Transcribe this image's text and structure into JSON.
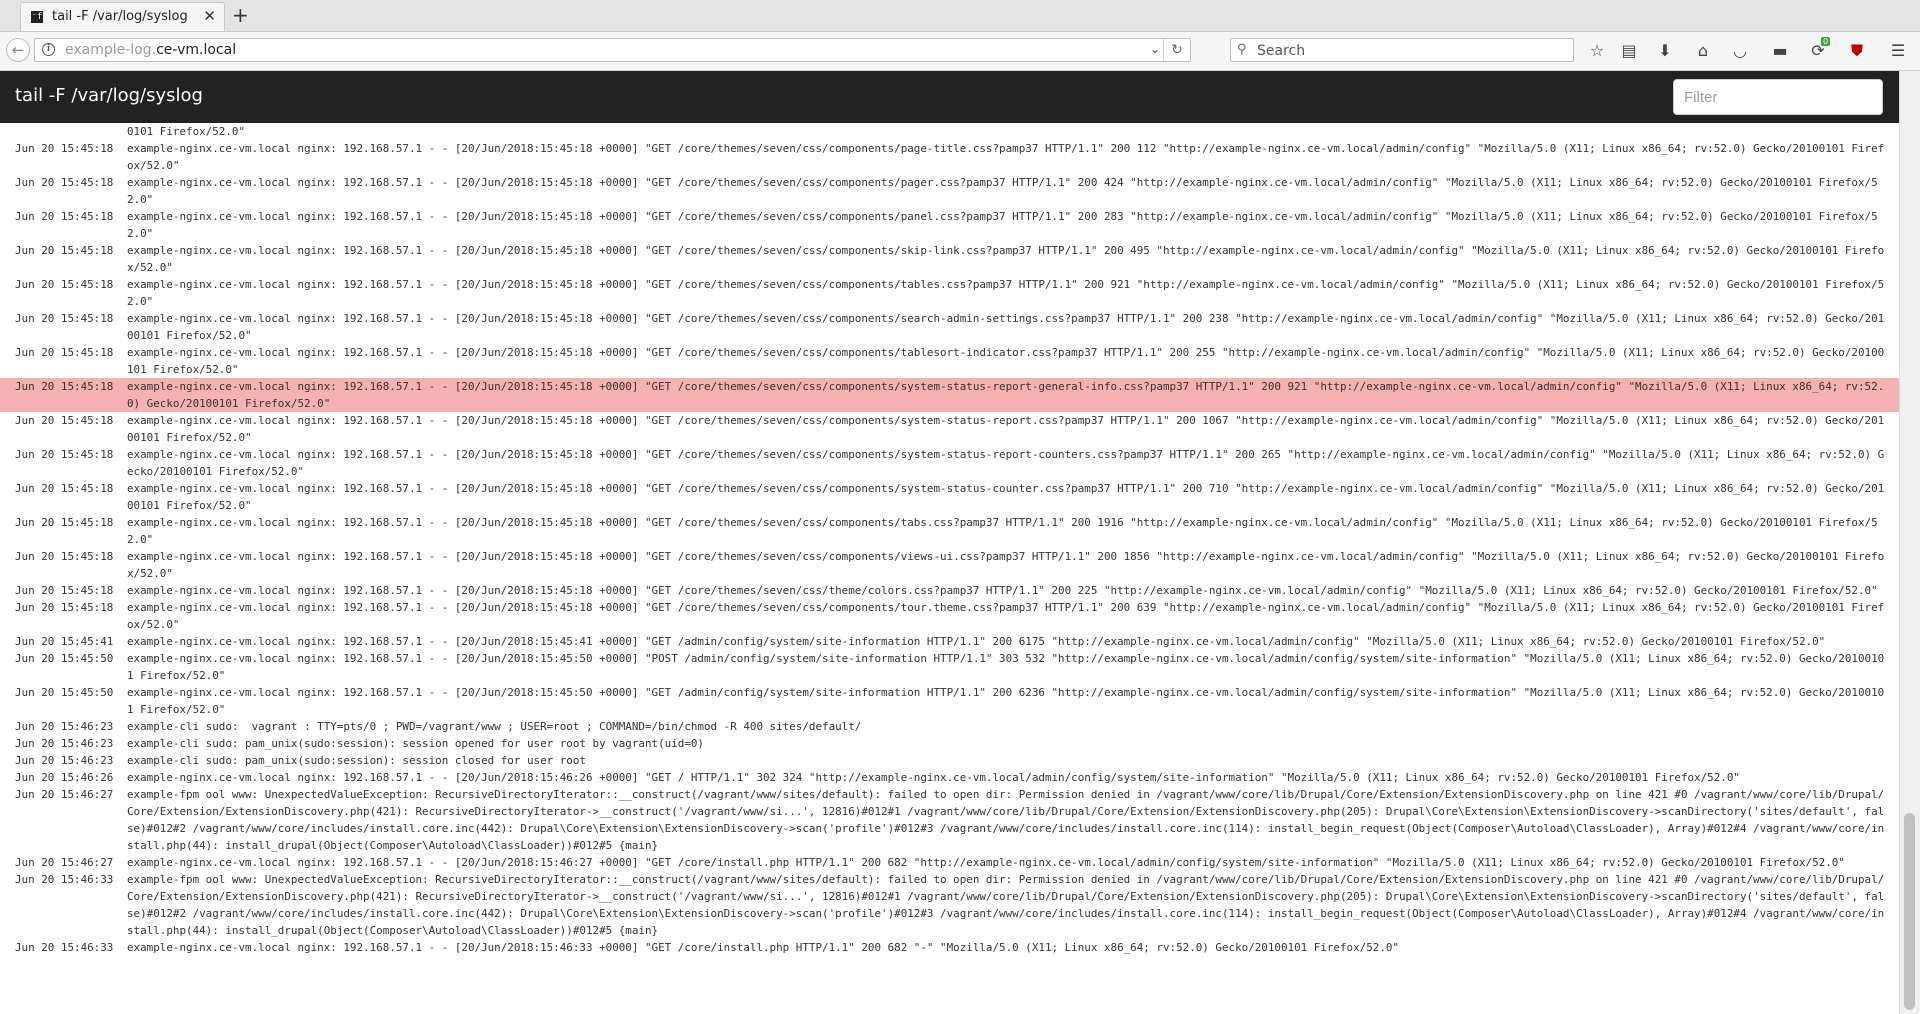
{
  "browser": {
    "tab_title": "tail -F /var/log/syslog",
    "tab_favicon_glyph": "⁻f",
    "url_prefix": "example-log.",
    "url_host": "ce-vm.local",
    "search_placeholder": "Search",
    "toolbar_icons": [
      "star-icon",
      "clipboard-icon",
      "download-icon",
      "home-icon",
      "pocket-icon",
      "extension-icon",
      "sync-icon",
      "ublock-icon",
      "menu-icon"
    ],
    "badge_count": "0"
  },
  "app": {
    "title": "tail -F /var/log/syslog",
    "filter_placeholder": "Filter"
  },
  "colors": {
    "header_bg": "#222222",
    "highlight_bg": "#f6b1b1"
  },
  "log_lines": [
    {
      "ts": "",
      "msg": "0101 Firefox/52.0\""
    },
    {
      "ts": "Jun 20 15:45:18",
      "msg": "example-nginx.ce-vm.local nginx: 192.168.57.1 - - [20/Jun/2018:15:45:18 +0000] \"GET /core/themes/seven/css/components/page-title.css?pamp37 HTTP/1.1\" 200 112 \"http://example-nginx.ce-vm.local/admin/config\" \"Mozilla/5.0 (X11; Linux x86_64; rv:52.0) Gecko/20100101 Firefox/52.0\""
    },
    {
      "ts": "Jun 20 15:45:18",
      "msg": "example-nginx.ce-vm.local nginx: 192.168.57.1 - - [20/Jun/2018:15:45:18 +0000] \"GET /core/themes/seven/css/components/pager.css?pamp37 HTTP/1.1\" 200 424 \"http://example-nginx.ce-vm.local/admin/config\" \"Mozilla/5.0 (X11; Linux x86_64; rv:52.0) Gecko/20100101 Firefox/52.0\""
    },
    {
      "ts": "Jun 20 15:45:18",
      "msg": "example-nginx.ce-vm.local nginx: 192.168.57.1 - - [20/Jun/2018:15:45:18 +0000] \"GET /core/themes/seven/css/components/panel.css?pamp37 HTTP/1.1\" 200 283 \"http://example-nginx.ce-vm.local/admin/config\" \"Mozilla/5.0 (X11; Linux x86_64; rv:52.0) Gecko/20100101 Firefox/52.0\""
    },
    {
      "ts": "Jun 20 15:45:18",
      "msg": "example-nginx.ce-vm.local nginx: 192.168.57.1 - - [20/Jun/2018:15:45:18 +0000] \"GET /core/themes/seven/css/components/skip-link.css?pamp37 HTTP/1.1\" 200 495 \"http://example-nginx.ce-vm.local/admin/config\" \"Mozilla/5.0 (X11; Linux x86_64; rv:52.0) Gecko/20100101 Firefox/52.0\""
    },
    {
      "ts": "Jun 20 15:45:18",
      "msg": "example-nginx.ce-vm.local nginx: 192.168.57.1 - - [20/Jun/2018:15:45:18 +0000] \"GET /core/themes/seven/css/components/tables.css?pamp37 HTTP/1.1\" 200 921 \"http://example-nginx.ce-vm.local/admin/config\" \"Mozilla/5.0 (X11; Linux x86_64; rv:52.0) Gecko/20100101 Firefox/52.0\""
    },
    {
      "ts": "Jun 20 15:45:18",
      "msg": "example-nginx.ce-vm.local nginx: 192.168.57.1 - - [20/Jun/2018:15:45:18 +0000] \"GET /core/themes/seven/css/components/search-admin-settings.css?pamp37 HTTP/1.1\" 200 238 \"http://example-nginx.ce-vm.local/admin/config\" \"Mozilla/5.0 (X11; Linux x86_64; rv:52.0) Gecko/20100101 Firefox/52.0\""
    },
    {
      "ts": "Jun 20 15:45:18",
      "msg": "example-nginx.ce-vm.local nginx: 192.168.57.1 - - [20/Jun/2018:15:45:18 +0000] \"GET /core/themes/seven/css/components/tablesort-indicator.css?pamp37 HTTP/1.1\" 200 255 \"http://example-nginx.ce-vm.local/admin/config\" \"Mozilla/5.0 (X11; Linux x86_64; rv:52.0) Gecko/20100101 Firefox/52.0\""
    },
    {
      "ts": "Jun 20 15:45:18",
      "msg": "example-nginx.ce-vm.local nginx: 192.168.57.1 - - [20/Jun/2018:15:45:18 +0000] \"GET /core/themes/seven/css/components/system-status-report-general-info.css?pamp37 HTTP/1.1\" 200 921 \"http://example-nginx.ce-vm.local/admin/config\" \"Mozilla/5.0 (X11; Linux x86_64; rv:52.0) Gecko/20100101 Firefox/52.0\"",
      "highlight": true
    },
    {
      "ts": "Jun 20 15:45:18",
      "msg": "example-nginx.ce-vm.local nginx: 192.168.57.1 - - [20/Jun/2018:15:45:18 +0000] \"GET /core/themes/seven/css/components/system-status-report.css?pamp37 HTTP/1.1\" 200 1067 \"http://example-nginx.ce-vm.local/admin/config\" \"Mozilla/5.0 (X11; Linux x86_64; rv:52.0) Gecko/20100101 Firefox/52.0\""
    },
    {
      "ts": "Jun 20 15:45:18",
      "msg": "example-nginx.ce-vm.local nginx: 192.168.57.1 - - [20/Jun/2018:15:45:18 +0000] \"GET /core/themes/seven/css/components/system-status-report-counters.css?pamp37 HTTP/1.1\" 200 265 \"http://example-nginx.ce-vm.local/admin/config\" \"Mozilla/5.0 (X11; Linux x86_64; rv:52.0) Gecko/20100101 Firefox/52.0\""
    },
    {
      "ts": "Jun 20 15:45:18",
      "msg": "example-nginx.ce-vm.local nginx: 192.168.57.1 - - [20/Jun/2018:15:45:18 +0000] \"GET /core/themes/seven/css/components/system-status-counter.css?pamp37 HTTP/1.1\" 200 710 \"http://example-nginx.ce-vm.local/admin/config\" \"Mozilla/5.0 (X11; Linux x86_64; rv:52.0) Gecko/20100101 Firefox/52.0\""
    },
    {
      "ts": "Jun 20 15:45:18",
      "msg": "example-nginx.ce-vm.local nginx: 192.168.57.1 - - [20/Jun/2018:15:45:18 +0000] \"GET /core/themes/seven/css/components/tabs.css?pamp37 HTTP/1.1\" 200 1916 \"http://example-nginx.ce-vm.local/admin/config\" \"Mozilla/5.0 (X11; Linux x86_64; rv:52.0) Gecko/20100101 Firefox/52.0\""
    },
    {
      "ts": "Jun 20 15:45:18",
      "msg": "example-nginx.ce-vm.local nginx: 192.168.57.1 - - [20/Jun/2018:15:45:18 +0000] \"GET /core/themes/seven/css/components/views-ui.css?pamp37 HTTP/1.1\" 200 1856 \"http://example-nginx.ce-vm.local/admin/config\" \"Mozilla/5.0 (X11; Linux x86_64; rv:52.0) Gecko/20100101 Firefox/52.0\""
    },
    {
      "ts": "Jun 20 15:45:18",
      "msg": "example-nginx.ce-vm.local nginx: 192.168.57.1 - - [20/Jun/2018:15:45:18 +0000] \"GET /core/themes/seven/css/theme/colors.css?pamp37 HTTP/1.1\" 200 225 \"http://example-nginx.ce-vm.local/admin/config\" \"Mozilla/5.0 (X11; Linux x86_64; rv:52.0) Gecko/20100101 Firefox/52.0\""
    },
    {
      "ts": "Jun 20 15:45:18",
      "msg": "example-nginx.ce-vm.local nginx: 192.168.57.1 - - [20/Jun/2018:15:45:18 +0000] \"GET /core/themes/seven/css/components/tour.theme.css?pamp37 HTTP/1.1\" 200 639 \"http://example-nginx.ce-vm.local/admin/config\" \"Mozilla/5.0 (X11; Linux x86_64; rv:52.0) Gecko/20100101 Firefox/52.0\""
    },
    {
      "ts": "Jun 20 15:45:41",
      "msg": "example-nginx.ce-vm.local nginx: 192.168.57.1 - - [20/Jun/2018:15:45:41 +0000] \"GET /admin/config/system/site-information HTTP/1.1\" 200 6175 \"http://example-nginx.ce-vm.local/admin/config\" \"Mozilla/5.0 (X11; Linux x86_64; rv:52.0) Gecko/20100101 Firefox/52.0\""
    },
    {
      "ts": "Jun 20 15:45:50",
      "msg": "example-nginx.ce-vm.local nginx: 192.168.57.1 - - [20/Jun/2018:15:45:50 +0000] \"POST /admin/config/system/site-information HTTP/1.1\" 303 532 \"http://example-nginx.ce-vm.local/admin/config/system/site-information\" \"Mozilla/5.0 (X11; Linux x86_64; rv:52.0) Gecko/20100101 Firefox/52.0\""
    },
    {
      "ts": "Jun 20 15:45:50",
      "msg": "example-nginx.ce-vm.local nginx: 192.168.57.1 - - [20/Jun/2018:15:45:50 +0000] \"GET /admin/config/system/site-information HTTP/1.1\" 200 6236 \"http://example-nginx.ce-vm.local/admin/config/system/site-information\" \"Mozilla/5.0 (X11; Linux x86_64; rv:52.0) Gecko/20100101 Firefox/52.0\""
    },
    {
      "ts": "Jun 20 15:46:23",
      "msg": "example-cli sudo:  vagrant : TTY=pts/0 ; PWD=/vagrant/www ; USER=root ; COMMAND=/bin/chmod -R 400 sites/default/"
    },
    {
      "ts": "Jun 20 15:46:23",
      "msg": "example-cli sudo: pam_unix(sudo:session): session opened for user root by vagrant(uid=0)"
    },
    {
      "ts": "Jun 20 15:46:23",
      "msg": "example-cli sudo: pam_unix(sudo:session): session closed for user root"
    },
    {
      "ts": "Jun 20 15:46:26",
      "msg": "example-nginx.ce-vm.local nginx: 192.168.57.1 - - [20/Jun/2018:15:46:26 +0000] \"GET / HTTP/1.1\" 302 324 \"http://example-nginx.ce-vm.local/admin/config/system/site-information\" \"Mozilla/5.0 (X11; Linux x86_64; rv:52.0) Gecko/20100101 Firefox/52.0\""
    },
    {
      "ts": "Jun 20 15:46:27",
      "msg": "example-fpm ool www: UnexpectedValueException: RecursiveDirectoryIterator::__construct(/vagrant/www/sites/default): failed to open dir: Permission denied in /vagrant/www/core/lib/Drupal/Core/Extension/ExtensionDiscovery.php on line 421 #0 /vagrant/www/core/lib/Drupal/Core/Extension/ExtensionDiscovery.php(421): RecursiveDirectoryIterator->__construct('/vagrant/www/si...', 12816)#012#1 /vagrant/www/core/lib/Drupal/Core/Extension/ExtensionDiscovery.php(205): Drupal\\Core\\Extension\\ExtensionDiscovery->scanDirectory('sites/default', false)#012#2 /vagrant/www/core/includes/install.core.inc(442): Drupal\\Core\\Extension\\ExtensionDiscovery->scan('profile')#012#3 /vagrant/www/core/includes/install.core.inc(114): install_begin_request(Object(Composer\\Autoload\\ClassLoader), Array)#012#4 /vagrant/www/core/install.php(44): install_drupal(Object(Composer\\Autoload\\ClassLoader))#012#5 {main}"
    },
    {
      "ts": "Jun 20 15:46:27",
      "msg": "example-nginx.ce-vm.local nginx: 192.168.57.1 - - [20/Jun/2018:15:46:27 +0000] \"GET /core/install.php HTTP/1.1\" 200 682 \"http://example-nginx.ce-vm.local/admin/config/system/site-information\" \"Mozilla/5.0 (X11; Linux x86_64; rv:52.0) Gecko/20100101 Firefox/52.0\""
    },
    {
      "ts": "Jun 20 15:46:33",
      "msg": "example-fpm ool www: UnexpectedValueException: RecursiveDirectoryIterator::__construct(/vagrant/www/sites/default): failed to open dir: Permission denied in /vagrant/www/core/lib/Drupal/Core/Extension/ExtensionDiscovery.php on line 421 #0 /vagrant/www/core/lib/Drupal/Core/Extension/ExtensionDiscovery.php(421): RecursiveDirectoryIterator->__construct('/vagrant/www/si...', 12816)#012#1 /vagrant/www/core/lib/Drupal/Core/Extension/ExtensionDiscovery.php(205): Drupal\\Core\\Extension\\ExtensionDiscovery->scanDirectory('sites/default', false)#012#2 /vagrant/www/core/includes/install.core.inc(442): Drupal\\Core\\Extension\\ExtensionDiscovery->scan('profile')#012#3 /vagrant/www/core/includes/install.core.inc(114): install_begin_request(Object(Composer\\Autoload\\ClassLoader), Array)#012#4 /vagrant/www/core/install.php(44): install_drupal(Object(Composer\\Autoload\\ClassLoader))#012#5 {main}"
    },
    {
      "ts": "Jun 20 15:46:33",
      "msg": "example-nginx.ce-vm.local nginx: 192.168.57.1 - - [20/Jun/2018:15:46:33 +0000] \"GET /core/install.php HTTP/1.1\" 200 682 \"-\" \"Mozilla/5.0 (X11; Linux x86_64; rv:52.0) Gecko/20100101 Firefox/52.0\""
    }
  ]
}
